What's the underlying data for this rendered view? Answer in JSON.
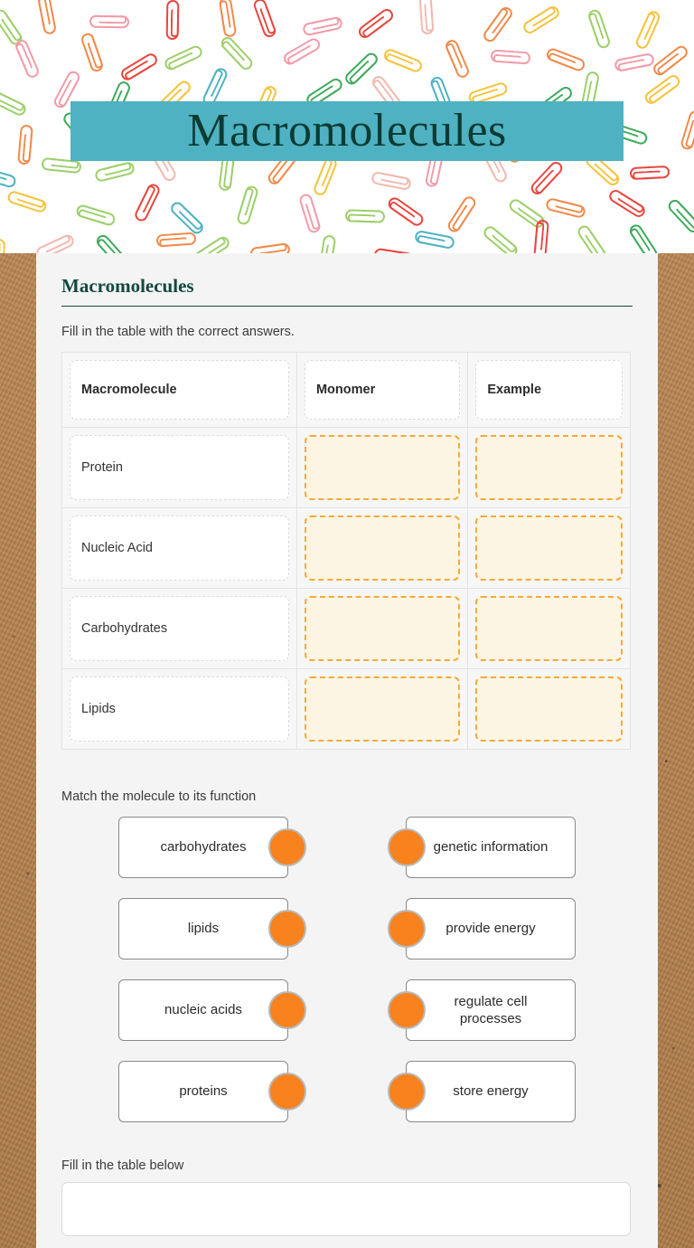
{
  "header": {
    "banner_title": "Macromolecules",
    "banner_color": "#4fb2c2",
    "title_color": "#0c3b33",
    "background": "paperclip-pattern",
    "clip_colors": [
      "#e8473f",
      "#4fb2c2",
      "#3faa5c",
      "#f5c33b",
      "#f29ba8",
      "#f08a4b",
      "#9ccf6a",
      "#f2b8ae"
    ]
  },
  "worksheet": {
    "title": "Macromolecules",
    "instruction_1": "Fill in the table with the correct answers.",
    "table": {
      "headers": [
        "Macromolecule",
        "Monomer",
        "Example"
      ],
      "rows": [
        {
          "label": "Protein",
          "monomer": "",
          "example": ""
        },
        {
          "label": "Nucleic Acid",
          "monomer": "",
          "example": ""
        },
        {
          "label": "Carbohydrates",
          "monomer": "",
          "example": ""
        },
        {
          "label": "Lipids",
          "monomer": "",
          "example": ""
        }
      ]
    },
    "matching": {
      "instruction": "Match the molecule to its function",
      "left": [
        "carbohydrates",
        "lipids",
        "nucleic acids",
        "proteins"
      ],
      "right": [
        "genetic information",
        "provide energy",
        "regulate cell processes",
        "store energy"
      ],
      "dot_color": "#f7821e"
    },
    "bottom": {
      "instruction": "Fill in the table below"
    },
    "colors": {
      "blank_fill": "#fdf5e3",
      "blank_border": "#f5a93c",
      "sheet_bg": "#f4f4f4",
      "title": "#12483d"
    }
  }
}
